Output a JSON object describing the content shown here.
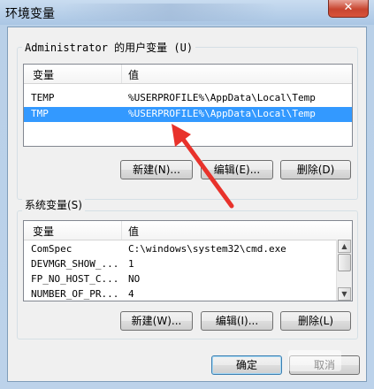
{
  "window": {
    "title": "环境变量",
    "close_glyph": "✕"
  },
  "user_vars": {
    "group_label": "Administrator 的用户变量 (U)",
    "columns": [
      "变量",
      "值"
    ],
    "rows": [
      {
        "name": "TEMP",
        "value": "%USERPROFILE%\\AppData\\Local\\Temp",
        "selected": false
      },
      {
        "name": "TMP",
        "value": "%USERPROFILE%\\AppData\\Local\\Temp",
        "selected": true
      }
    ],
    "buttons": {
      "new": "新建(N)...",
      "edit": "编辑(E)...",
      "delete": "删除(D)"
    }
  },
  "system_vars": {
    "group_label": "系统变量(S)",
    "columns": [
      "变量",
      "值"
    ],
    "rows": [
      {
        "name": "ComSpec",
        "value": "C:\\windows\\system32\\cmd.exe"
      },
      {
        "name": "DEVMGR_SHOW_...",
        "value": "1"
      },
      {
        "name": "FP_NO_HOST_C...",
        "value": "NO"
      },
      {
        "name": "NUMBER_OF_PR...",
        "value": "4"
      }
    ],
    "buttons": {
      "new": "新建(W)...",
      "edit": "编辑(I)...",
      "delete": "删除(L)"
    }
  },
  "footer": {
    "ok": "确定",
    "cancel": "取消"
  },
  "colors": {
    "selection": "#3399ff",
    "annotation_arrow": "#e8322b"
  }
}
